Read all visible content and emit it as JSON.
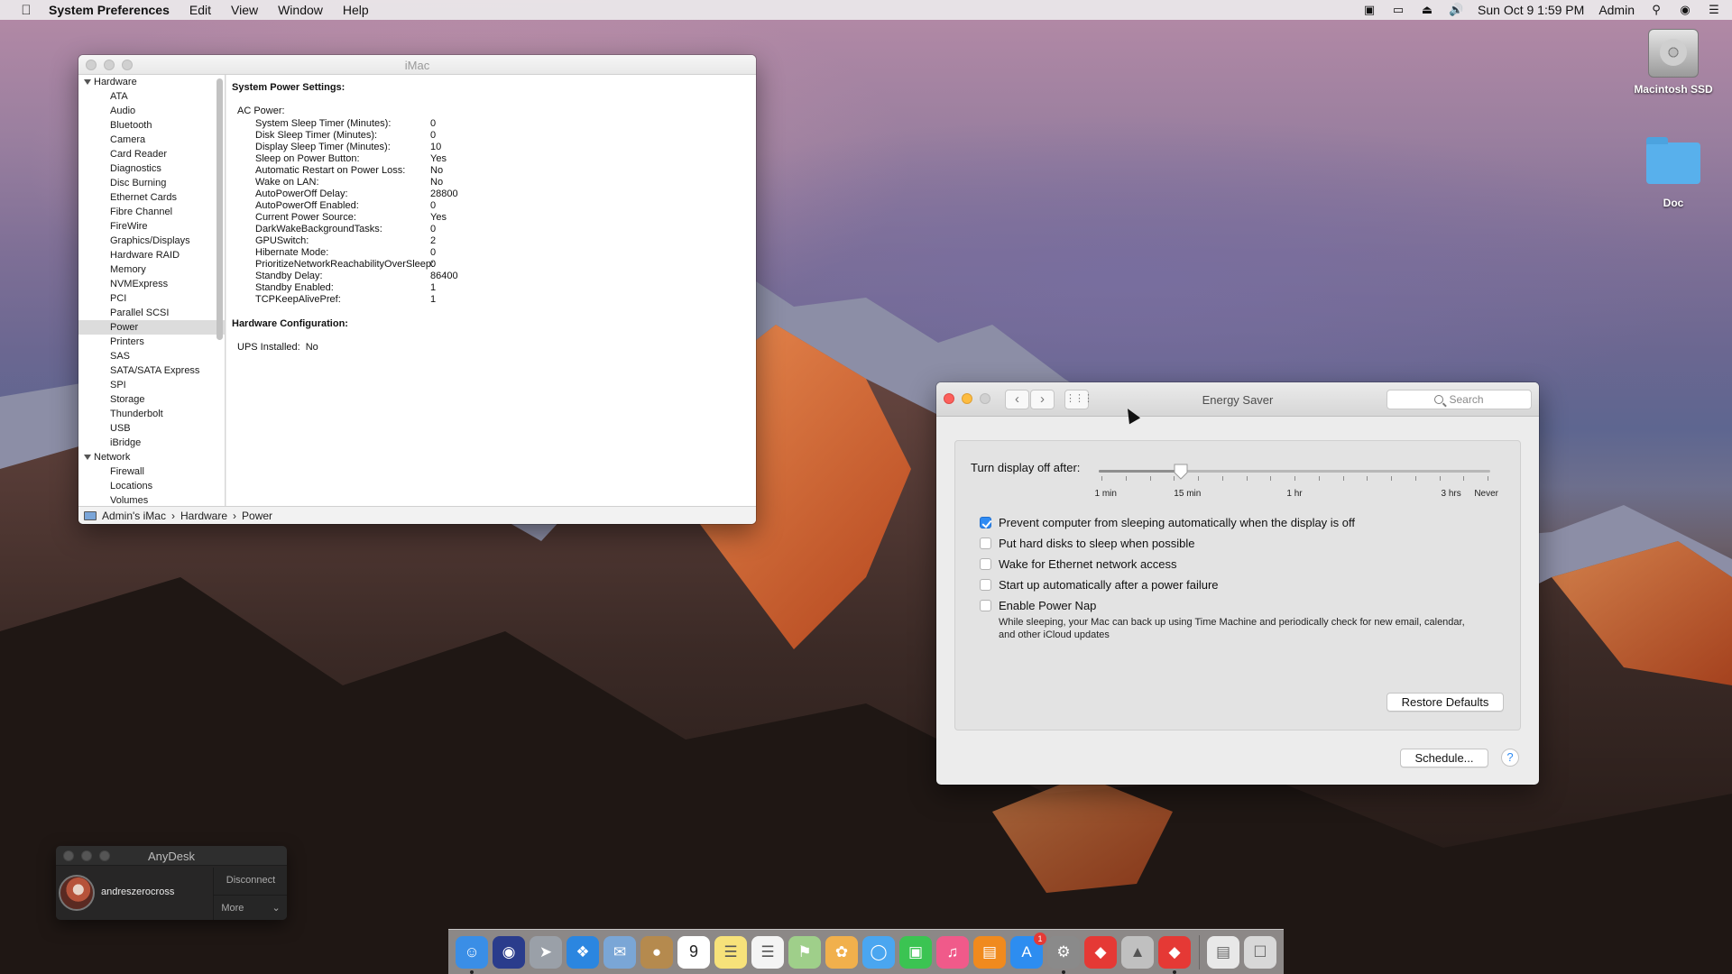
{
  "menubar": {
    "app_name": "System Preferences",
    "menus": [
      "Edit",
      "View",
      "Window",
      "Help"
    ],
    "datetime": "Sun Oct 9  1:59 PM",
    "user": "Admin",
    "status_icons": [
      "display-mirroring-icon",
      "airplay-icon",
      "eject-icon",
      "volume-icon",
      "spotlight-icon",
      "siri-icon",
      "notification-center-icon"
    ]
  },
  "sysinfo": {
    "title": "iMac",
    "sidebar": {
      "hardware_group": "Hardware",
      "hardware_items": [
        "ATA",
        "Audio",
        "Bluetooth",
        "Camera",
        "Card Reader",
        "Diagnostics",
        "Disc Burning",
        "Ethernet Cards",
        "Fibre Channel",
        "FireWire",
        "Graphics/Displays",
        "Hardware RAID",
        "Memory",
        "NVMExpress",
        "PCI",
        "Parallel SCSI",
        "Power",
        "Printers",
        "SAS",
        "SATA/SATA Express",
        "SPI",
        "Storage",
        "Thunderbolt",
        "USB",
        "iBridge"
      ],
      "selected": "Power",
      "network_group": "Network",
      "network_items": [
        "Firewall",
        "Locations",
        "Volumes"
      ]
    },
    "main": {
      "heading1": "System Power Settings:",
      "subheading": "AC Power:",
      "rows": [
        {
          "k": "System Sleep Timer (Minutes):",
          "v": "0"
        },
        {
          "k": "Disk Sleep Timer (Minutes):",
          "v": "0"
        },
        {
          "k": "Display Sleep Timer (Minutes):",
          "v": "10"
        },
        {
          "k": "Sleep on Power Button:",
          "v": "Yes"
        },
        {
          "k": "Automatic Restart on Power Loss:",
          "v": "No"
        },
        {
          "k": "Wake on LAN:",
          "v": "No"
        },
        {
          "k": "AutoPowerOff Delay:",
          "v": "28800"
        },
        {
          "k": "AutoPowerOff Enabled:",
          "v": "0"
        },
        {
          "k": "Current Power Source:",
          "v": "Yes"
        },
        {
          "k": "DarkWakeBackgroundTasks:",
          "v": "0"
        },
        {
          "k": "GPUSwitch:",
          "v": "2"
        },
        {
          "k": "Hibernate Mode:",
          "v": "0"
        },
        {
          "k": "PrioritizeNetworkReachabilityOverSleep:",
          "v": "0"
        },
        {
          "k": "Standby Delay:",
          "v": "86400"
        },
        {
          "k": "Standby Enabled:",
          "v": "1"
        },
        {
          "k": "TCPKeepAlivePref:",
          "v": "1"
        }
      ],
      "heading2": "Hardware Configuration:",
      "ups_label": "UPS Installed:",
      "ups_value": "No"
    },
    "path": {
      "computer": "Admin's iMac",
      "sep": "›",
      "section": "Hardware",
      "item": "Power"
    }
  },
  "energy": {
    "title": "Energy Saver",
    "search_placeholder": "Search",
    "slider_label": "Turn display off after:",
    "slider_ticks": [
      "1 min",
      "15 min",
      "1 hr",
      "3 hrs",
      "Never"
    ],
    "slider_value_fraction": 0.21,
    "checkboxes": [
      {
        "label": "Prevent computer from sleeping automatically when the display is off",
        "checked": true
      },
      {
        "label": "Put hard disks to sleep when possible",
        "checked": false
      },
      {
        "label": "Wake for Ethernet network access",
        "checked": false
      },
      {
        "label": "Start up automatically after a power failure",
        "checked": false
      },
      {
        "label": "Enable Power Nap",
        "checked": false
      }
    ],
    "power_nap_note": "While sleeping, your Mac can back up using Time Machine and periodically check for new email, calendar, and other iCloud updates",
    "restore_defaults": "Restore Defaults",
    "schedule": "Schedule...",
    "help": "?"
  },
  "anydesk": {
    "title": "AnyDesk",
    "user": "andreszerocross",
    "disconnect": "Disconnect",
    "more": "More"
  },
  "desktop": {
    "icons": [
      "Macintosh SSD",
      "Doc"
    ]
  },
  "dock": {
    "apps": [
      {
        "name": "finder-icon",
        "color": "#3a8ee6"
      },
      {
        "name": "siri-icon",
        "color": "#2a3c8c"
      },
      {
        "name": "launchpad-icon",
        "color": "#9aa0a8"
      },
      {
        "name": "safari-icon",
        "color": "#2b86e0"
      },
      {
        "name": "mail-icon",
        "color": "#7aa6d6"
      },
      {
        "name": "contacts-icon",
        "color": "#b58a4e"
      },
      {
        "name": "calendar-icon",
        "color": "#ffffff"
      },
      {
        "name": "notes-icon",
        "color": "#f7e27a"
      },
      {
        "name": "reminders-icon",
        "color": "#f4f4f4"
      },
      {
        "name": "maps-icon",
        "color": "#9fcf8a"
      },
      {
        "name": "photos-icon",
        "color": "#f1b04c"
      },
      {
        "name": "messages-icon",
        "color": "#4aa6f0"
      },
      {
        "name": "facetime-icon",
        "color": "#3bc452"
      },
      {
        "name": "itunes-icon",
        "color": "#f05a8a"
      },
      {
        "name": "ibooks-icon",
        "color": "#f08a1e"
      },
      {
        "name": "app-store-icon",
        "color": "#2d8df0"
      },
      {
        "name": "system-preferences-icon",
        "color": "#8a8a8a"
      },
      {
        "name": "anydesk-icon",
        "color": "#e53935"
      },
      {
        "name": "ssh-icon",
        "color": "#c0c0c0"
      },
      {
        "name": "anydesk-connected-icon",
        "color": "#e53935"
      }
    ],
    "calendar_day": "9",
    "appstore_badge": "1",
    "right_items": [
      {
        "name": "downloads-icon",
        "color": "#e8e8e8"
      },
      {
        "name": "trash-icon",
        "color": "#d8d8d8"
      }
    ]
  }
}
